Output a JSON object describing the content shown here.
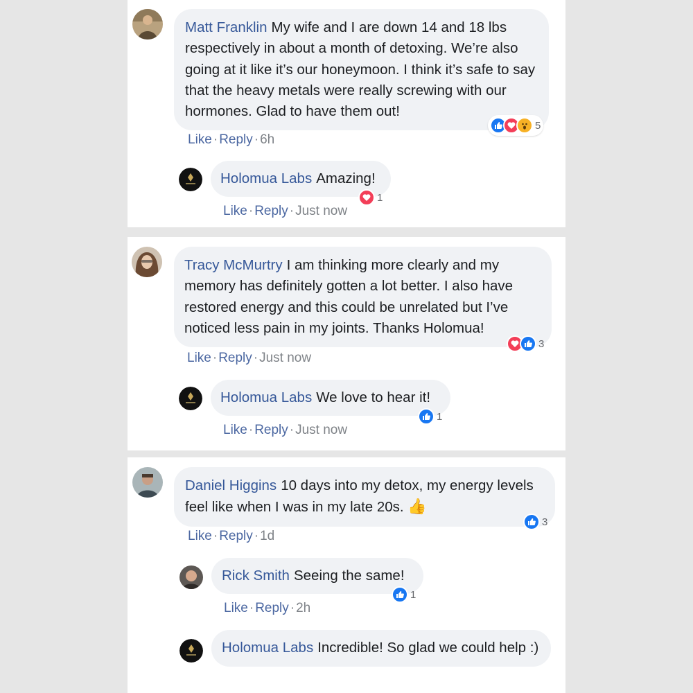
{
  "colors": {
    "background": "#e6e6e6",
    "card": "#ffffff",
    "bubble": "#f0f2f5",
    "name": "#365899",
    "action_link": "#4b67a1",
    "like_reaction": "#1877f2",
    "love_reaction": "#f33e58",
    "wow_reaction": "#f7b125"
  },
  "threads": [
    {
      "comment": {
        "author": "Matt Franklin",
        "text": "My wife and I are down 14 and 18 lbs respectively in about a month of detoxing. We’re also going at it like it’s our honeymoon. I think it’s safe to say that the heavy metals were really screwing with our hormones. Glad to have them out!",
        "reactions": [
          "like-icon",
          "love-icon",
          "wow-icon"
        ],
        "reaction_count": "5",
        "like": "Like",
        "reply": "Reply",
        "time": "6h"
      },
      "replies": [
        {
          "author": "Holomua Labs",
          "text": "Amazing!",
          "reactions": [
            "love-icon"
          ],
          "reaction_count": "1",
          "like": "Like",
          "reply": "Reply",
          "time": "Just now"
        }
      ]
    },
    {
      "comment": {
        "author": "Tracy McMurtry",
        "text": "I am thinking more clearly and my memory has definitely gotten a lot better. I also have restored energy and this could be unrelated but I’ve noticed less pain in my joints. Thanks Holomua!",
        "reactions": [
          "love-icon",
          "like-icon"
        ],
        "reaction_count": "3",
        "like": "Like",
        "reply": "Reply",
        "time": "Just now"
      },
      "replies": [
        {
          "author": "Holomua Labs",
          "text": "We love to hear it!",
          "reactions": [
            "like-icon"
          ],
          "reaction_count": "1",
          "like": "Like",
          "reply": "Reply",
          "time": "Just now"
        }
      ]
    },
    {
      "comment": {
        "author": "Daniel Higgins",
        "text": "10 days into my detox, my energy levels feel like when I was in my late 20s.",
        "emoji": "👍",
        "reactions": [
          "like-icon"
        ],
        "reaction_count": "3",
        "like": "Like",
        "reply": "Reply",
        "time": "1d"
      },
      "replies": [
        {
          "author": "Rick Smith",
          "text": "Seeing the same!",
          "reactions": [
            "like-icon"
          ],
          "reaction_count": "1",
          "like": "Like",
          "reply": "Reply",
          "time": "2h"
        },
        {
          "author": "Holomua Labs",
          "text": "Incredible! So glad we could help :)"
        }
      ]
    }
  ]
}
